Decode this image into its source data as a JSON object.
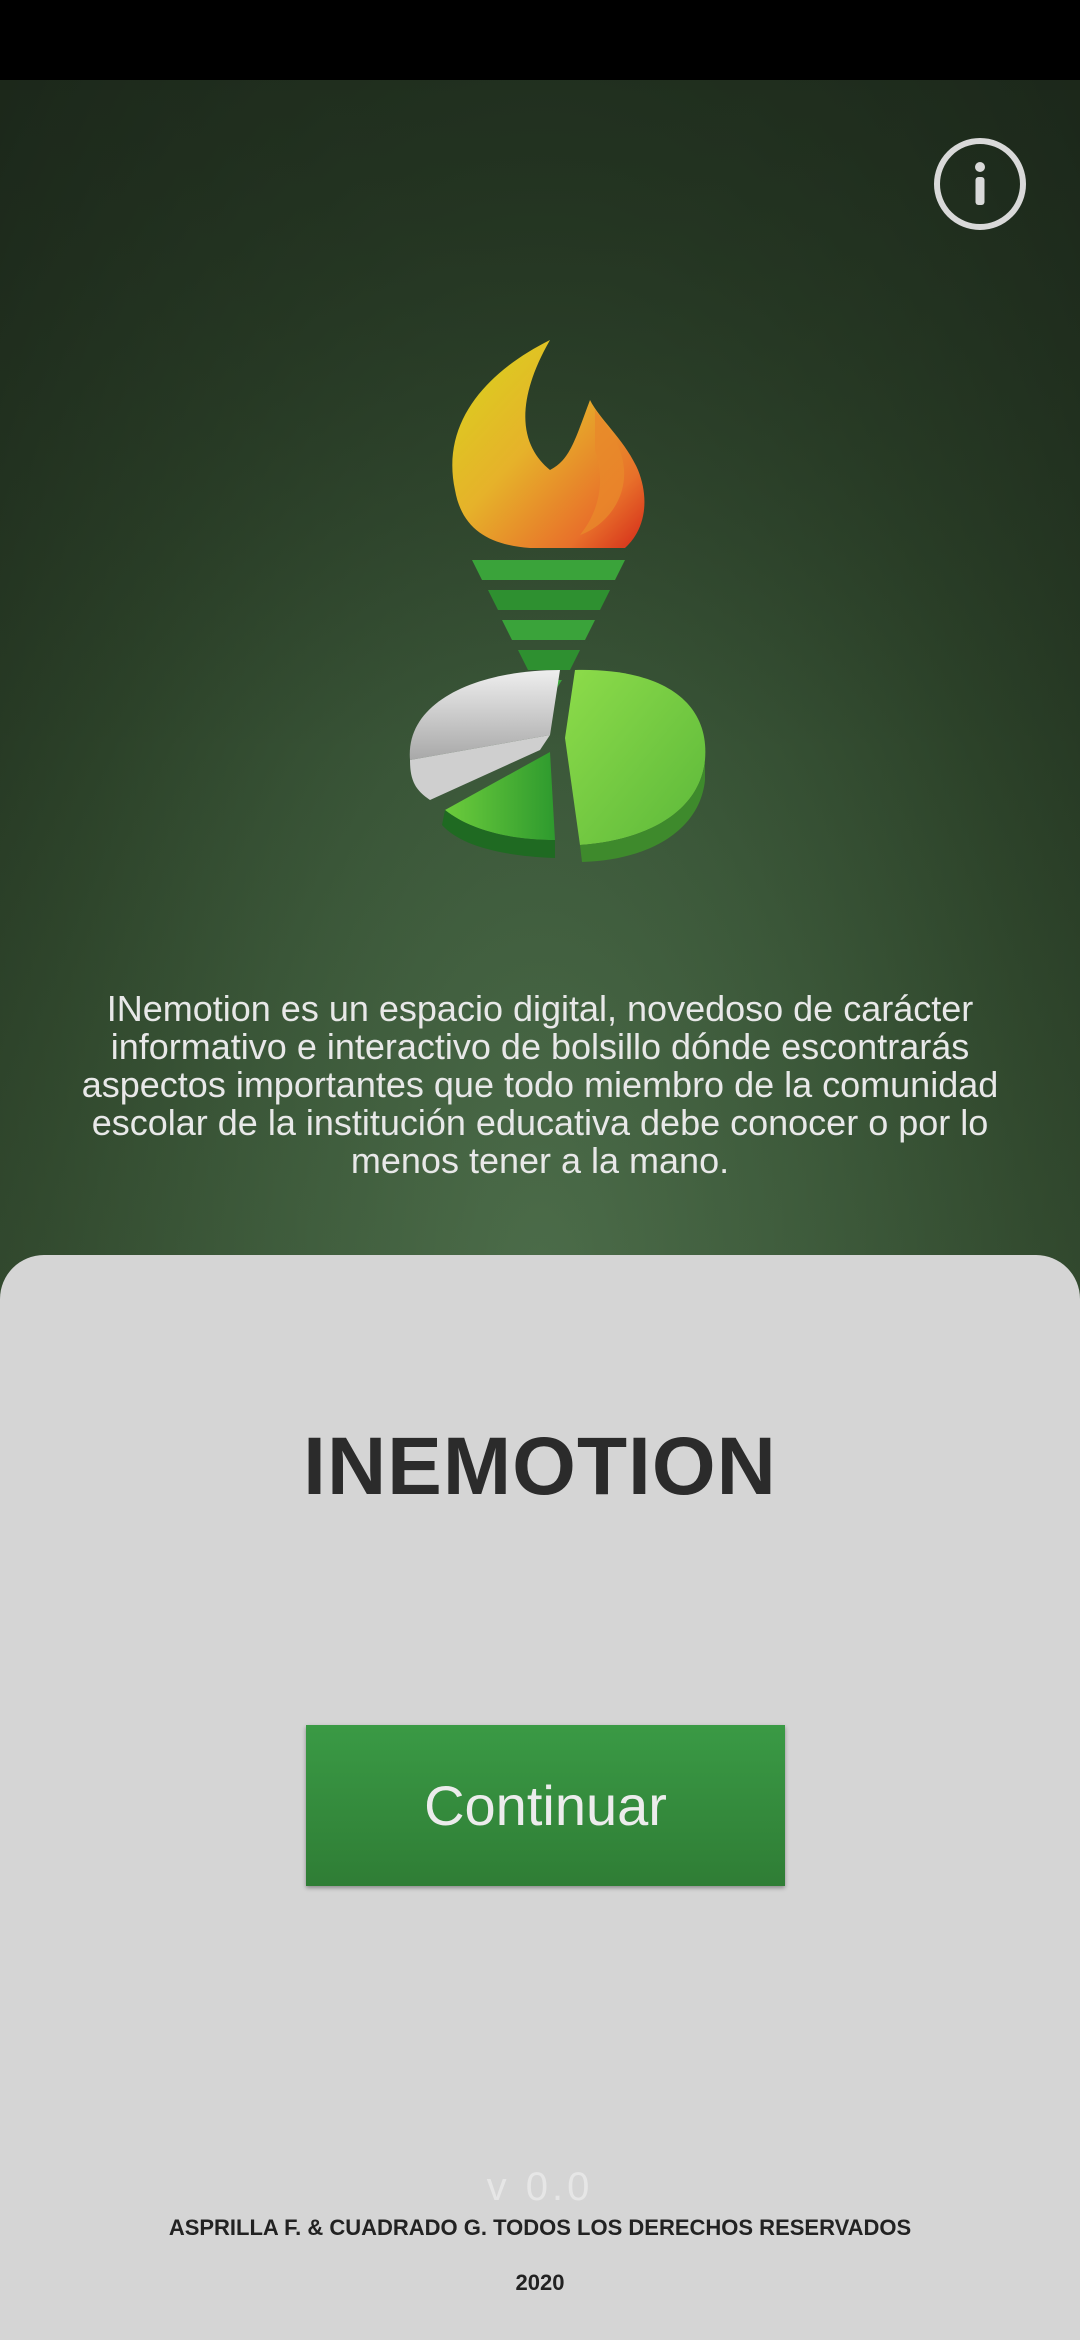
{
  "hero": {
    "info_icon": "info-icon",
    "logo_icon": "torch-pie-chart-logo",
    "description": "INemotion es un espacio digital, novedoso de carácter informativo e interactivo de bolsillo dónde escontrarás aspectos importantes que todo miembro de la comunidad escolar de la institución educativa debe conocer o por lo menos tener a la mano."
  },
  "panel": {
    "title": "INEMOTION",
    "continue_label": "Continuar",
    "version": "v 0.0",
    "copyright": "ASPRILLA F. & CUADRADO G. TODOS LOS DERECHOS RESERVADOS",
    "year": "2020"
  },
  "colors": {
    "primary_green": "#2f8a3a",
    "panel_bg": "#d5d5d5",
    "hero_dark": "#1f2d1d"
  }
}
